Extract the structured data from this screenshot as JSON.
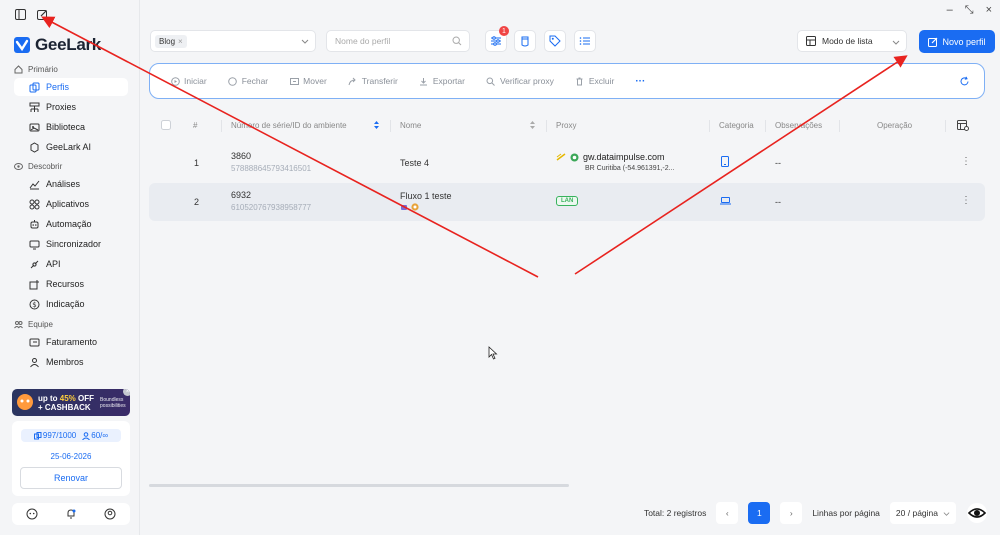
{
  "app": {
    "name": "GeeLark"
  },
  "sidebar": {
    "sections": [
      {
        "label": "Primário"
      },
      {
        "label": "Descobrir"
      },
      {
        "label": "Equipe"
      }
    ],
    "items": [
      {
        "label": "Perfis",
        "icon": "profiles-icon"
      },
      {
        "label": "Proxies",
        "icon": "proxies-icon"
      },
      {
        "label": "Biblioteca",
        "icon": "library-icon"
      },
      {
        "label": "GeeLark AI",
        "icon": "ai-icon"
      },
      {
        "label": "Análises",
        "icon": "analytics-icon"
      },
      {
        "label": "Aplicativos",
        "icon": "apps-icon"
      },
      {
        "label": "Automação",
        "icon": "automation-icon"
      },
      {
        "label": "Sincronizador",
        "icon": "sync-icon"
      },
      {
        "label": "API",
        "icon": "api-icon"
      },
      {
        "label": "Recursos",
        "icon": "resources-icon"
      },
      {
        "label": "Indicação",
        "icon": "referral-icon"
      },
      {
        "label": "Faturamento",
        "icon": "billing-icon"
      },
      {
        "label": "Membros",
        "icon": "members-icon"
      }
    ],
    "promo": {
      "line_a": "up to",
      "pct": "45%",
      "off": "OFF",
      "line_b": "+ CASHBACK",
      "tag1": "Boundless",
      "tag2": "possibilities"
    },
    "quota": {
      "profiles": "997/1000",
      "members": "60/∞"
    },
    "expiry": "25-06-2026",
    "renew_label": "Renovar"
  },
  "toolbar": {
    "group_chip": "Blog",
    "search_placeholder": "Nome do perfil",
    "filter_badge": "1",
    "view_mode": "Modo de lista",
    "new_profile": "Novo perfil"
  },
  "actions": [
    "Iniciar",
    "Fechar",
    "Mover",
    "Transferir",
    "Exportar",
    "Verificar proxy",
    "Excluir"
  ],
  "more_label": "···",
  "table": {
    "headers": {
      "num": "#",
      "serial": "Número de série/ID do ambiente",
      "name": "Nome",
      "proxy": "Proxy",
      "category": "Categoria",
      "notes": "Observações",
      "operation": "Operação"
    },
    "rows": [
      {
        "index": "1",
        "serial": "3860",
        "env_id": "578888645793416501",
        "name": "Teste 4",
        "proxy_host": "gw.dataimpulse.com",
        "proxy_loc": "BR Curitiba (-54.961391,-2...",
        "notes": "--"
      },
      {
        "index": "2",
        "serial": "6932",
        "env_id": "610520767938958777",
        "name": "Fluxo 1 teste",
        "proxy_tag": "LAN",
        "notes": "--"
      }
    ]
  },
  "pagination": {
    "total": "Total: 2 registros",
    "current": "1",
    "per_page_label": "Linhas por página",
    "per_page_value": "20 / página"
  },
  "colors": {
    "accent": "#1a6cf2",
    "annotation": "#e8231f"
  }
}
